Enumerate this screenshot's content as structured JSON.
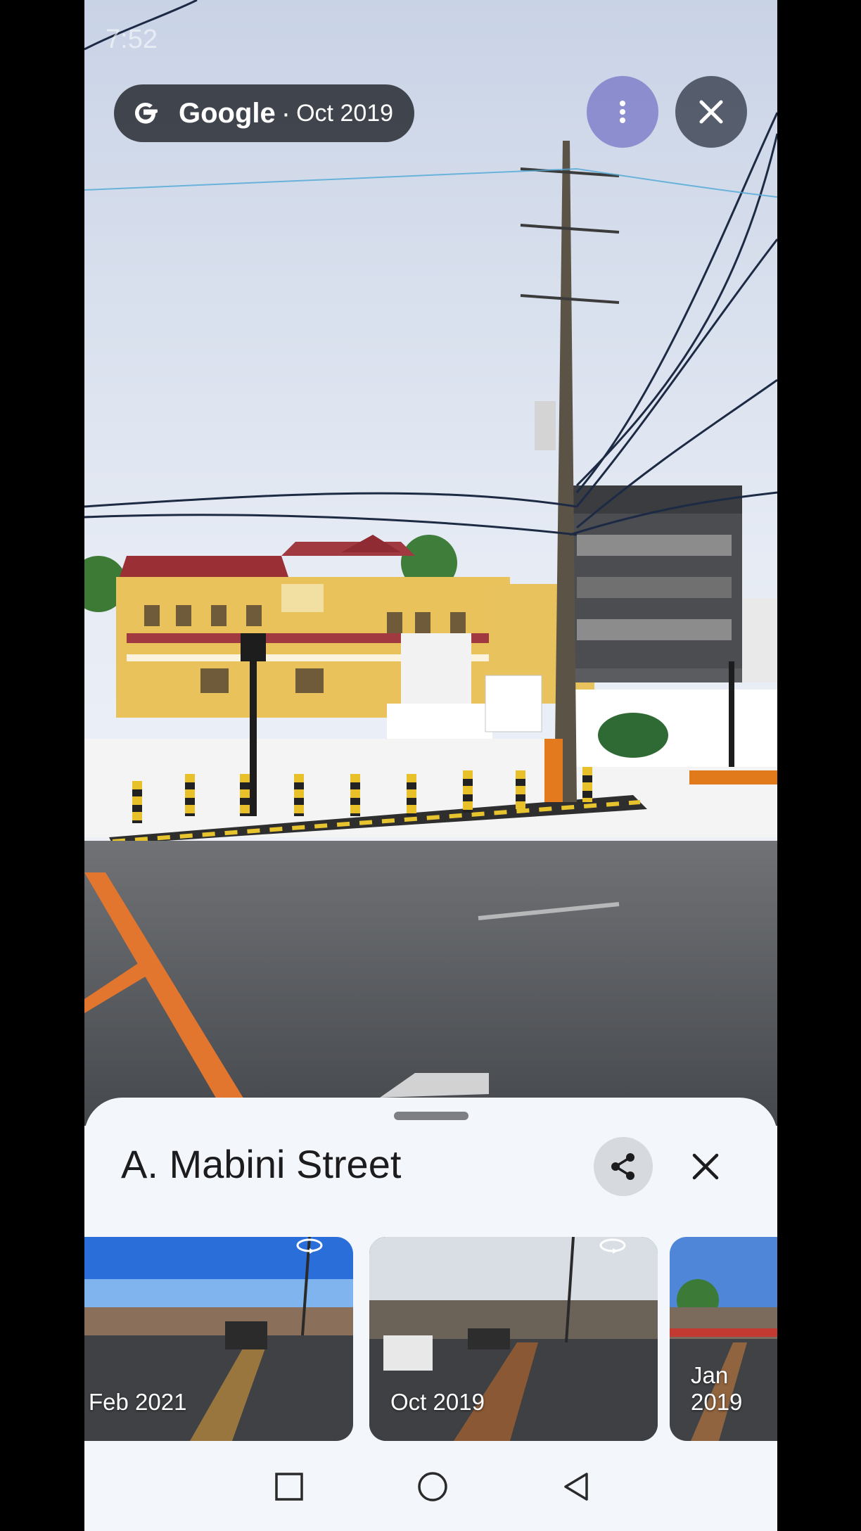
{
  "status_bar": {
    "time": "7:52"
  },
  "header": {
    "brand": "Google",
    "separator": "·",
    "date": "Oct 2019"
  },
  "sheet": {
    "title": "A. Mabini Street"
  },
  "timeline": [
    {
      "label": "Feb 2021",
      "selected": false
    },
    {
      "label": "Oct 2019",
      "selected": true
    },
    {
      "label": "Jan 2019",
      "selected": false
    }
  ],
  "icons": {
    "google_logo": "google-g-icon",
    "more": "more-vertical-icon",
    "close": "close-icon",
    "share": "share-icon",
    "pano": "360-rotate-icon",
    "recents": "recents-square-icon",
    "home": "home-circle-icon",
    "back": "back-triangle-icon"
  },
  "colors": {
    "selected_outline": "#0f5e63",
    "sheet_bg": "#f3f6fa"
  }
}
